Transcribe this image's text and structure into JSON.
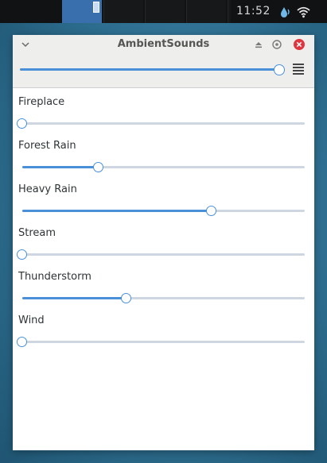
{
  "panel": {
    "clock": "11:52",
    "workspaces": 5,
    "active_workspace": 0
  },
  "window": {
    "title": "AmbientSounds",
    "master_volume": 1.0,
    "sounds": [
      {
        "label": "Fireplace",
        "value": 0.0
      },
      {
        "label": "Forest Rain",
        "value": 0.27
      },
      {
        "label": "Heavy Rain",
        "value": 0.67
      },
      {
        "label": "Stream",
        "value": 0.0
      },
      {
        "label": "Thunderstorm",
        "value": 0.37
      },
      {
        "label": "Wind",
        "value": 0.0
      }
    ]
  },
  "colors": {
    "accent": "#4a90d9",
    "track": "#cdd6e1",
    "close": "#e0353f"
  },
  "icons": [
    "chevron-down-icon",
    "eject-icon",
    "restore-icon",
    "close-icon",
    "hamburger-menu-icon",
    "water-drop-icon",
    "wifi-icon"
  ]
}
